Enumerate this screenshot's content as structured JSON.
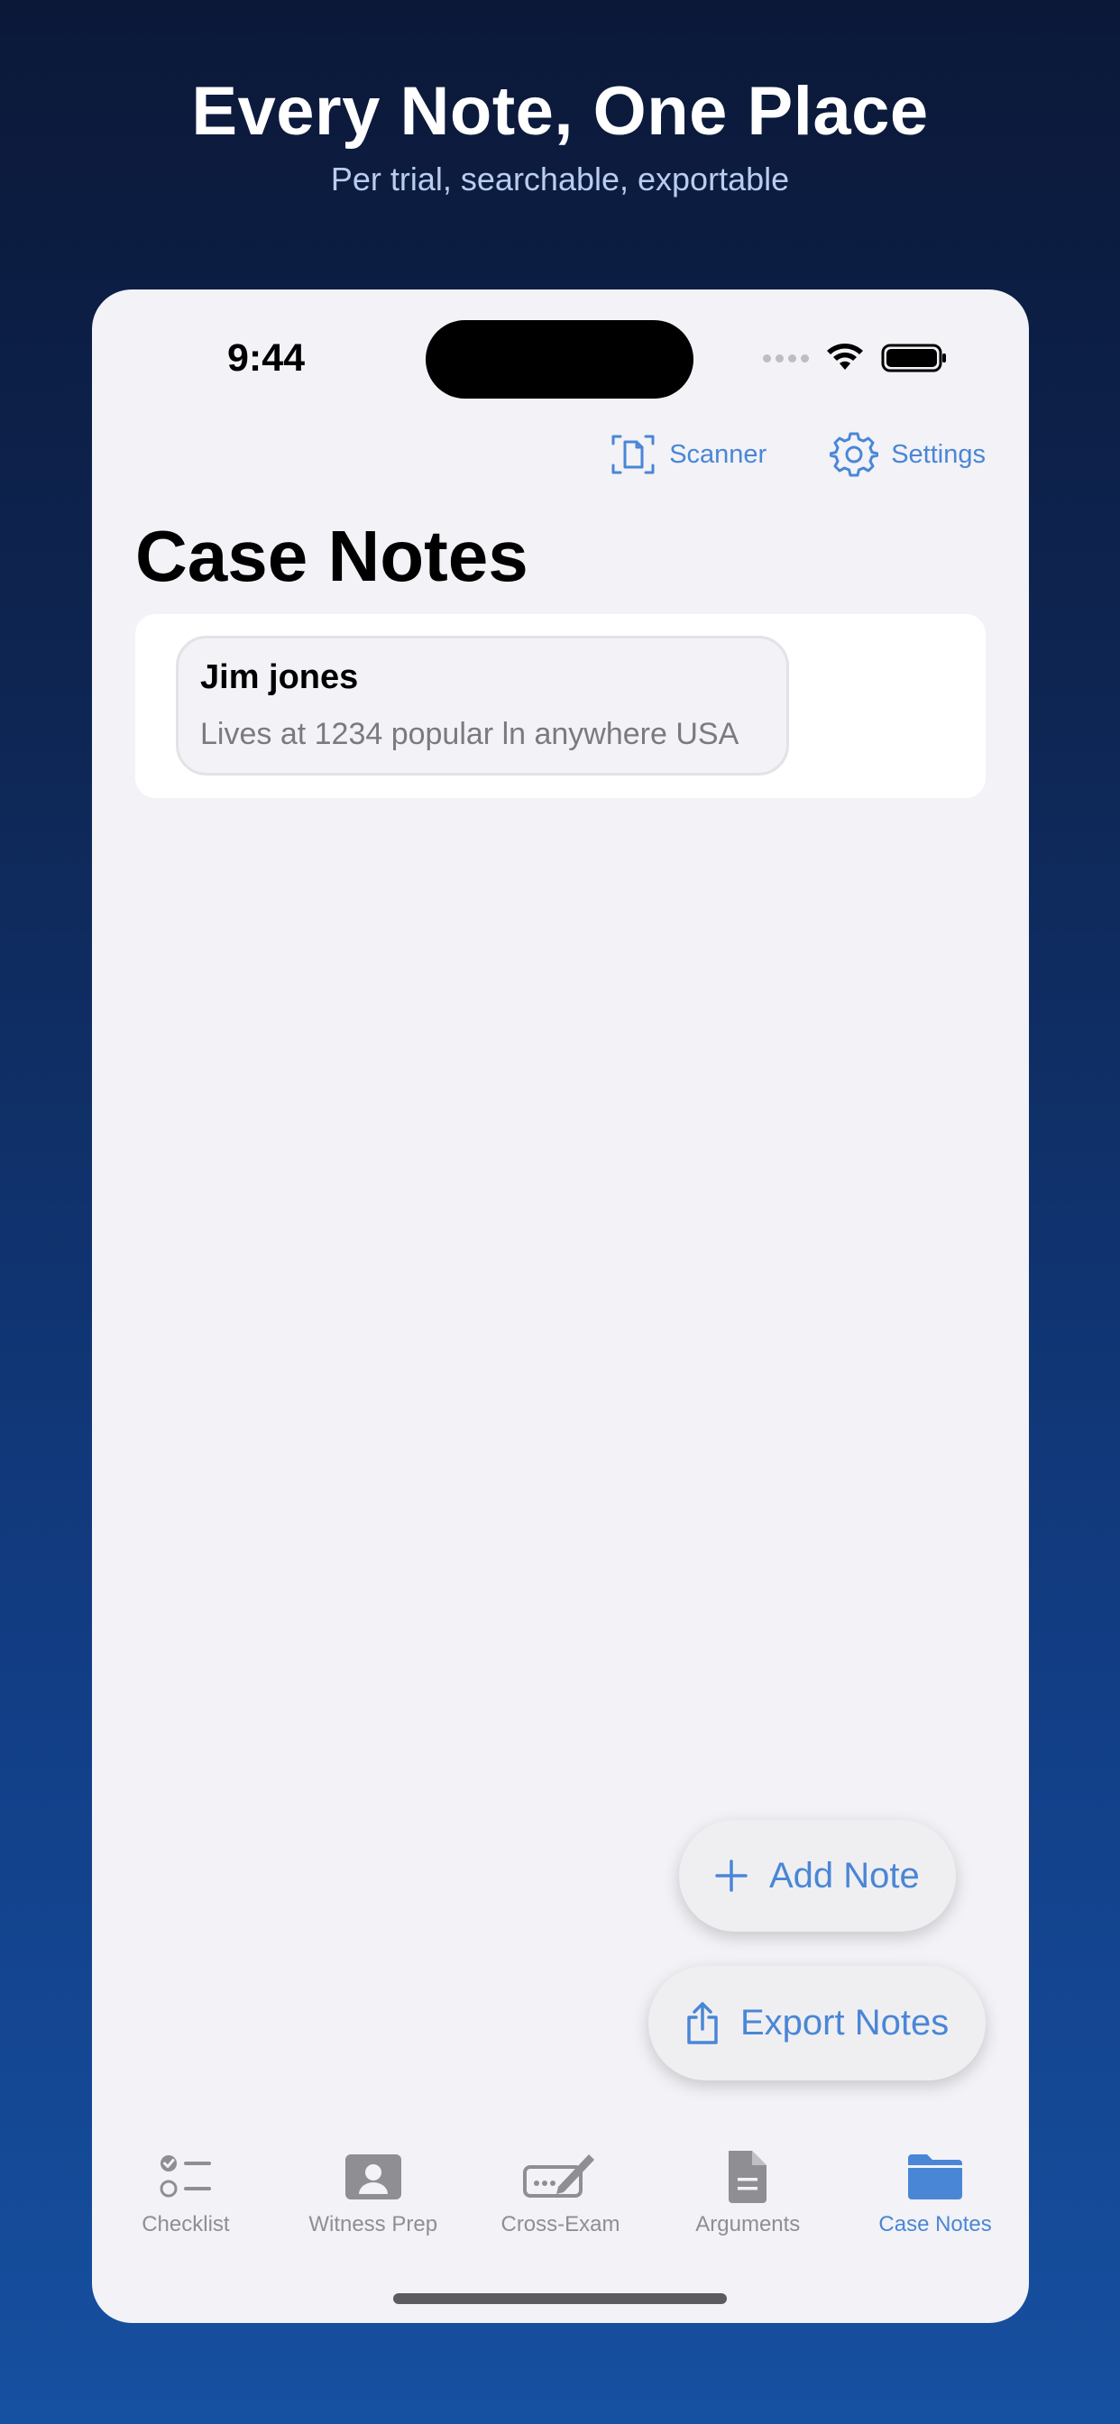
{
  "hero": {
    "title": "Every Note, One Place",
    "subtitle": "Per trial, searchable, exportable"
  },
  "status_bar": {
    "time": "9:44"
  },
  "toolbar": {
    "scanner_label": "Scanner",
    "settings_label": "Settings"
  },
  "page": {
    "title": "Case Notes"
  },
  "notes": [
    {
      "title": "Jim jones",
      "body": "Lives at 1234 popular ln anywhere USA"
    }
  ],
  "actions": {
    "add_note_label": "Add Note",
    "export_notes_label": "Export Notes"
  },
  "tabs": [
    {
      "label": "Checklist",
      "icon": "checklist-icon",
      "active": false
    },
    {
      "label": "Witness Prep",
      "icon": "person-card-icon",
      "active": false
    },
    {
      "label": "Cross-Exam",
      "icon": "keyboard-pencil-icon",
      "active": false
    },
    {
      "label": "Arguments",
      "icon": "document-icon",
      "active": false
    },
    {
      "label": "Case Notes",
      "icon": "folder-icon",
      "active": true
    }
  ],
  "colors": {
    "accent": "#4a86d6",
    "inactive_tab": "#8e8e93",
    "background": "#f2f2f7"
  }
}
